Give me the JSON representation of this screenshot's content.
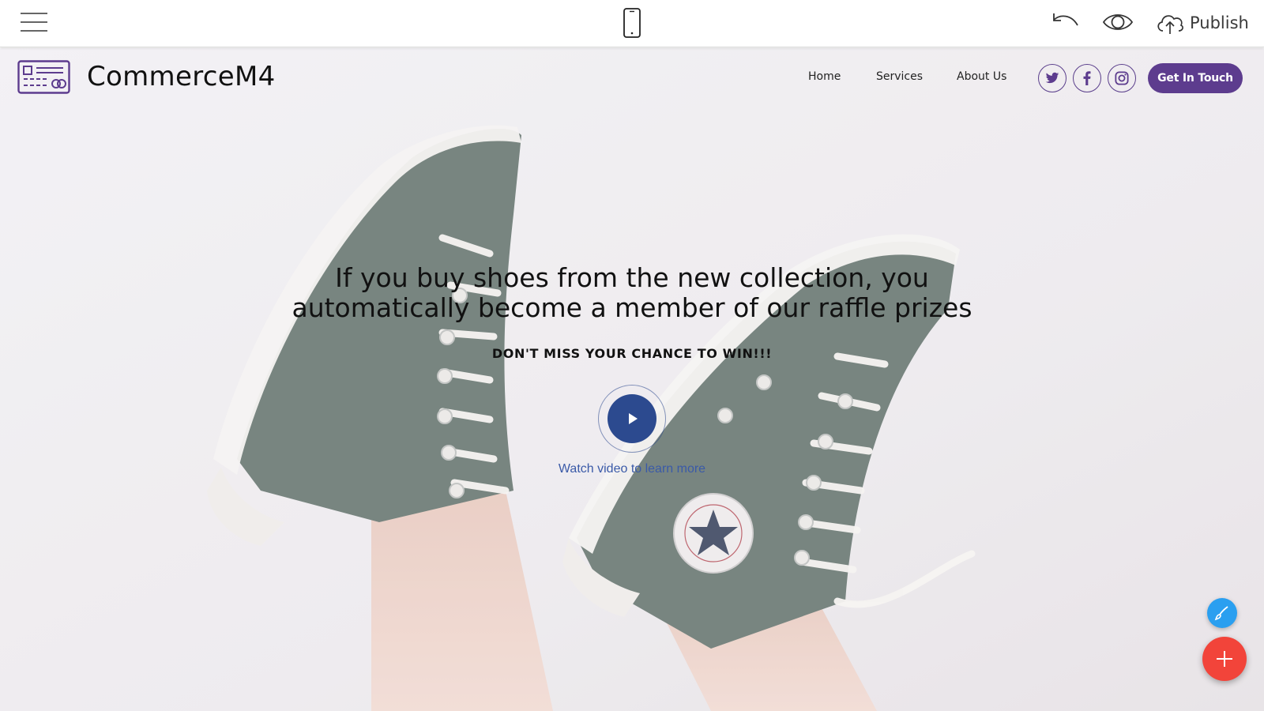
{
  "toolbar": {
    "menu_icon": "hamburger-menu-icon",
    "device_icon": "mobile-phone-icon",
    "undo_icon": "undo-icon",
    "preview_icon": "eye-icon",
    "publish_icon": "cloud-upload-icon",
    "publish_label": "Publish"
  },
  "site": {
    "brand": "CommerceM4",
    "logo_icon": "id-card-logo-icon",
    "nav": [
      "Home",
      "Services",
      "About Us"
    ],
    "social_icons": [
      "twitter-icon",
      "facebook-icon",
      "instagram-icon"
    ],
    "cta_label": "Get In Touch",
    "accent_color": "#5d3c8e"
  },
  "hero": {
    "headline_line1": "If you buy shoes from the new collection, you",
    "headline_line2": "automatically become a member of our raffle prizes",
    "subline": "DON'T MISS YOUR CHANCE TO WIN!!!",
    "play_icon": "play-icon",
    "video_link": "Watch video to learn more",
    "background_image": "green-converse-sneakers-photo"
  },
  "floating": {
    "style_icon": "brush-icon",
    "add_icon": "plus-icon",
    "style_color": "#2a9ff0",
    "add_color": "#f2443a"
  }
}
